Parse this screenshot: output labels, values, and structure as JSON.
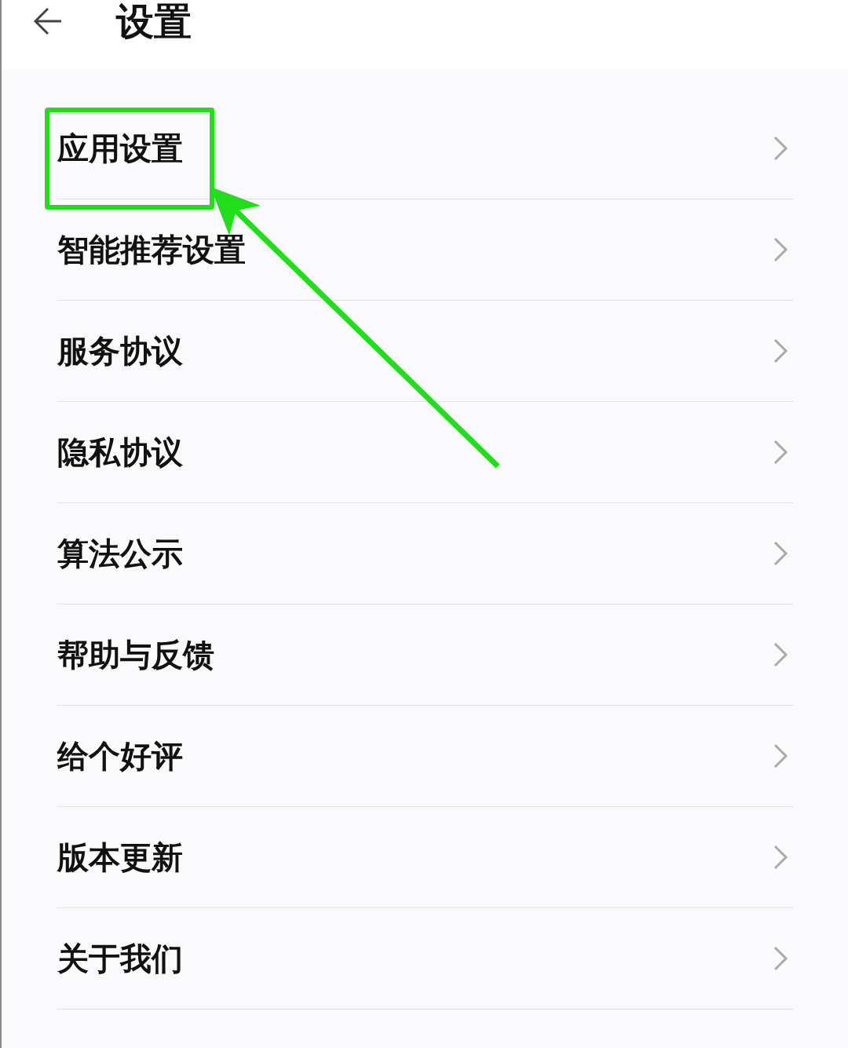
{
  "header": {
    "title": "设置"
  },
  "items": [
    {
      "label": "应用设置",
      "highlighted": true
    },
    {
      "label": "智能推荐设置",
      "highlighted": false
    },
    {
      "label": "服务协议",
      "highlighted": false
    },
    {
      "label": "隐私协议",
      "highlighted": false
    },
    {
      "label": "算法公示",
      "highlighted": false
    },
    {
      "label": "帮助与反馈",
      "highlighted": false
    },
    {
      "label": "给个好评",
      "highlighted": false
    },
    {
      "label": "版本更新",
      "highlighted": false
    },
    {
      "label": "关于我们",
      "highlighted": false
    }
  ]
}
